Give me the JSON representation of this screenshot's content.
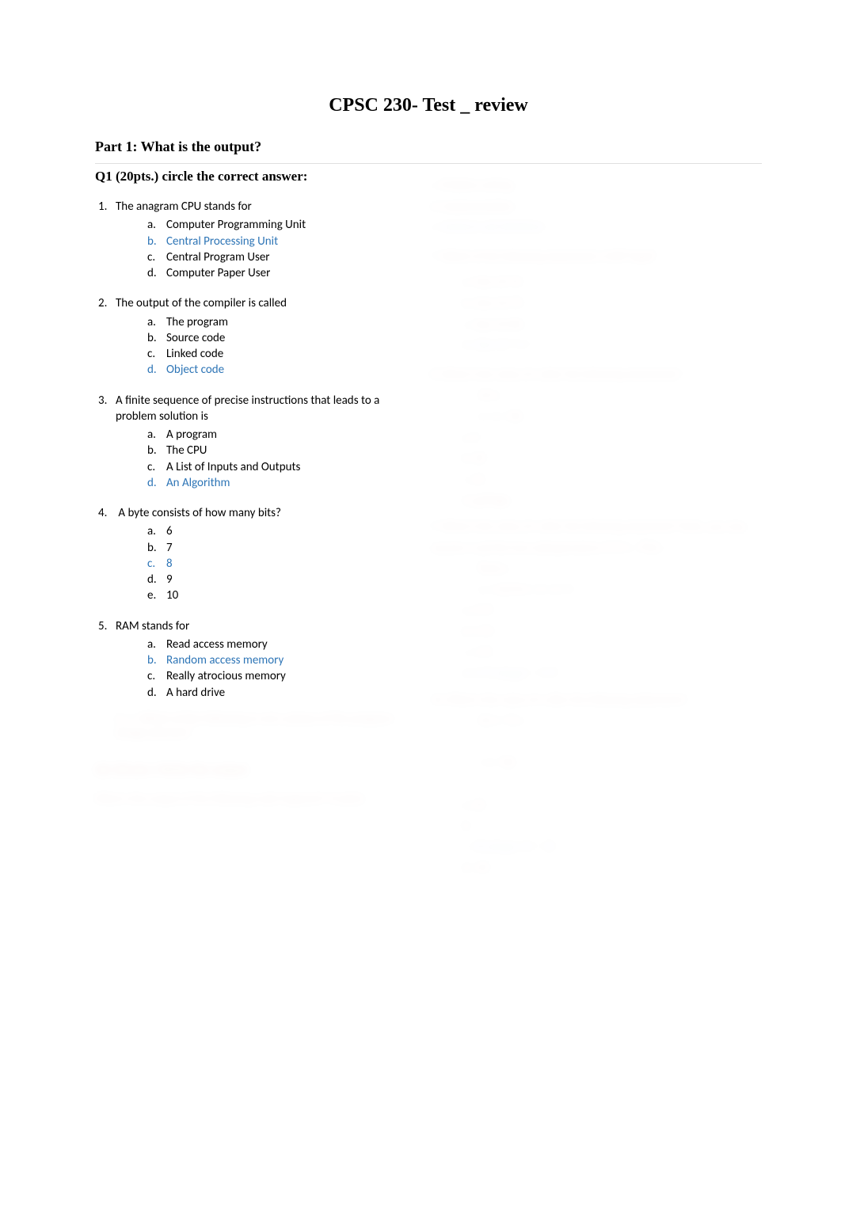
{
  "title": "CPSC 230- Test _  review",
  "part1_heading": "Part 1:  What is the output?",
  "q1_heading": "Q1 (20pts.) circle the correct answer:",
  "questions": [
    {
      "num": "1.",
      "text": "The anagram CPU stands for",
      "options": [
        {
          "letter": "a.",
          "text": "Computer Programming Unit",
          "correct": false
        },
        {
          "letter": "b.",
          "text": "Central Processing Unit",
          "correct": true
        },
        {
          "letter": "c.",
          "text": "Central Program User",
          "correct": false
        },
        {
          "letter": "d.",
          "text": "Computer Paper User",
          "correct": false
        }
      ]
    },
    {
      "num": "2.",
      "text": "The output of the compiler is called",
      "options": [
        {
          "letter": "a.",
          "text": "The program",
          "correct": false
        },
        {
          "letter": "b.",
          "text": "Source code",
          "correct": false
        },
        {
          "letter": "c.",
          "text": "Linked code",
          "correct": false
        },
        {
          "letter": "d.",
          "text": "Object code",
          "correct": true
        }
      ]
    },
    {
      "num": "3.",
      "text": "A finite sequence of  precise instructions that leads to a problem solution is",
      "options": [
        {
          "letter": "a.",
          "text": "A program",
          "correct": false
        },
        {
          "letter": "b.",
          "text": "The CPU",
          "correct": false
        },
        {
          "letter": "c.",
          "text": "A List of Inputs and Outputs",
          "correct": false
        },
        {
          "letter": "d.",
          "text": "An Algorithm",
          "correct": true
        }
      ]
    },
    {
      "num": "4.",
      "text": " A byte consists of how many bits?",
      "options": [
        {
          "letter": "a.",
          "text": "6",
          "correct": false
        },
        {
          "letter": "b.",
          "text": "7",
          "correct": false
        },
        {
          "letter": "c.",
          "text": "8",
          "correct": true
        },
        {
          "letter": "d.",
          "text": "9",
          "correct": false
        },
        {
          "letter": "e.",
          "text": "10",
          "correct": false
        }
      ]
    },
    {
      "num": "5.",
      "text": "RAM stands for",
      "options": [
        {
          "letter": "a.",
          "text": "Read access memory",
          "correct": false
        },
        {
          "letter": "b.",
          "text": "Random access memory",
          "correct": true
        },
        {
          "letter": "c.",
          "text": "Really atrocious memory",
          "correct": false
        },
        {
          "letter": "d.",
          "text": "A hard drive",
          "correct": false
        }
      ]
    }
  ],
  "hidden_right": {
    "lines": [
      "c.   Problem solving",
      "d.   Implementation",
      "e.   Analysis and definition",
      "7.   Which of the following statements is NOT legal?",
      "a.   char ch='b';",
      "b.   char ch='0';",
      "c.   char ch=65;",
      "d.   char ch=\"cc\";",
      "8.   What is the value of x after the following statements?",
      "int x;",
      "x = x + 30;",
      "a.   0",
      "b.   30",
      "c.   33",
      "d.   garbage",
      "9.   What is the value of x after the following statement? Note, you may assume x and the two subexpressions (7/2 2 , 7%2) ...",
      "float x;",
      "x = 3.0/4.0 + 3 + 2 / 5",
      "a.   5.75",
      "b.   5.75",
      "c.   1.75",
      "d.   3.75    integer = 3.75",
      "10. What is the value of x after the following statements?",
      "int x = 0; x",
      "i",
      "= x + 30;",
      "}",
      "a.   10",
      "b.   -",
      "c.   30    integer 10 + 30",
      "d.   -40"
    ]
  },
  "hidden_bottom_left": {
    "q6": "6.   c- Which of the following is not a phase of the program-design process?",
    "q2heading": "Q2 (20 pts.) Write the output",
    "q2text": "What is the output of the following code fragment? (4 pt(s))"
  }
}
